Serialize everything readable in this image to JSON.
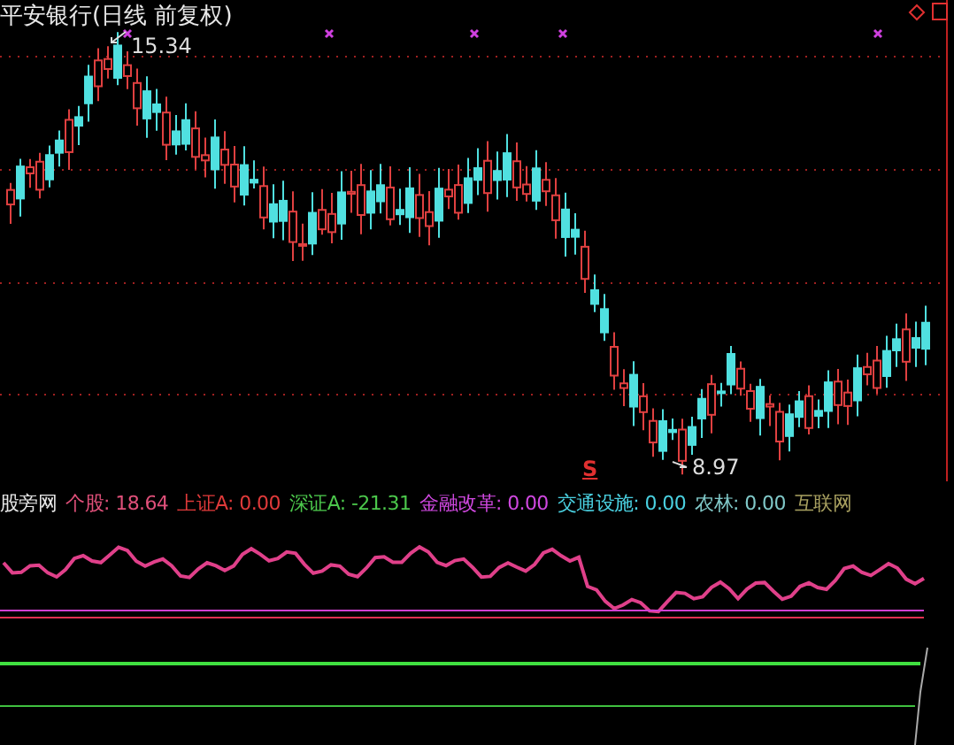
{
  "chart": {
    "title": "平安银行(日线 前复权)",
    "high_label": "15.34",
    "low_label": "8.97",
    "signal": "S"
  },
  "indicator": {
    "name": "股旁网",
    "items": [
      {
        "label": "个股:",
        "value": "18.64",
        "color": "#e0507a"
      },
      {
        "label": "上证A:",
        "value": "0.00",
        "color": "#e03a3a"
      },
      {
        "label": "深证A:",
        "value": "-21.31",
        "color": "#4cc84c"
      },
      {
        "label": "金融改革:",
        "value": "0.00",
        "color": "#d048e0"
      },
      {
        "label": "交通设施:",
        "value": "0.00",
        "color": "#4ad0e0"
      },
      {
        "label": "农林:",
        "value": "0.00",
        "color": "#80c8c8"
      },
      {
        "label": "互联网",
        "color": "#a8a060"
      }
    ]
  }
}
